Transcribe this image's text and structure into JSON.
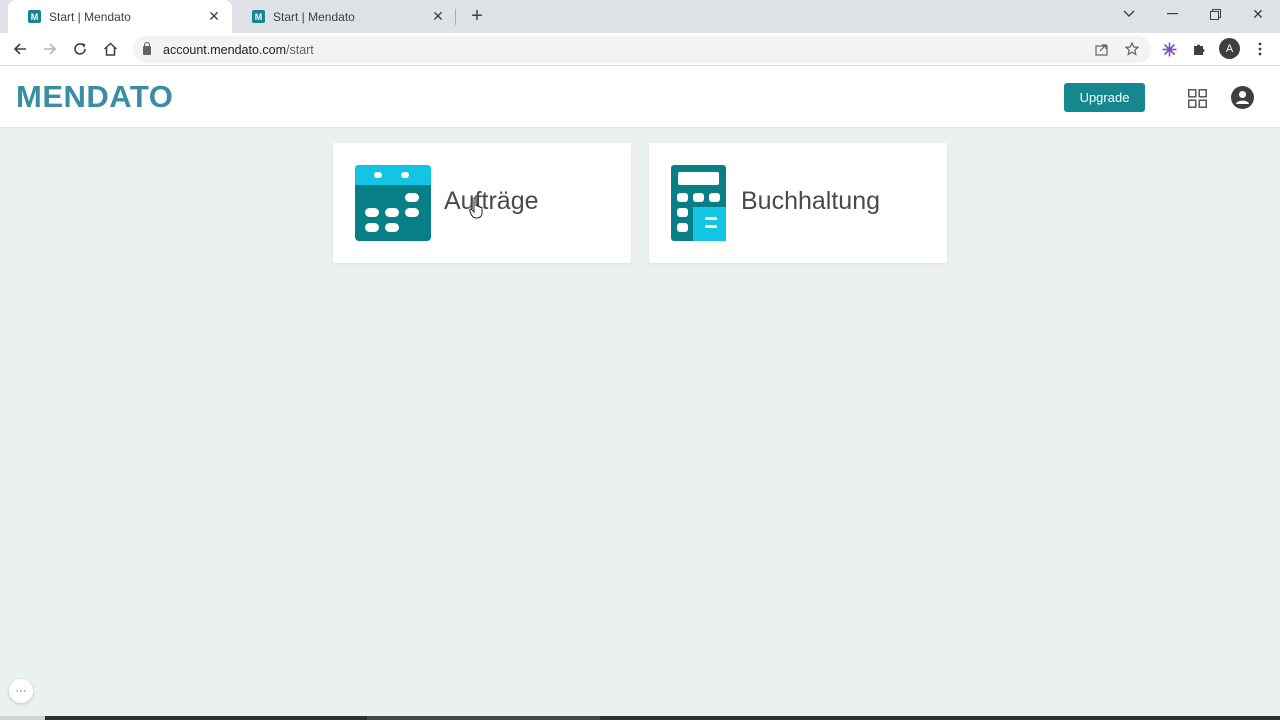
{
  "browser": {
    "tabs": [
      {
        "title": "Start | Mendato",
        "favicon": "M",
        "active": true
      },
      {
        "title": "Start | Mendato",
        "favicon": "M",
        "active": false
      }
    ],
    "url_host": "account.mendato.com",
    "url_path": "/start",
    "profile_initial": "A"
  },
  "header": {
    "logo": "MENDATO",
    "upgrade_label": "Upgrade"
  },
  "cards": [
    {
      "label": "Aufträge",
      "icon": "calendar-icon"
    },
    {
      "label": "Buchhaltung",
      "icon": "calculator-icon"
    }
  ],
  "colors": {
    "brand": "#14878f",
    "icon_dark": "#087e86",
    "icon_light": "#14c4e4",
    "background": "#ebf0f0"
  }
}
